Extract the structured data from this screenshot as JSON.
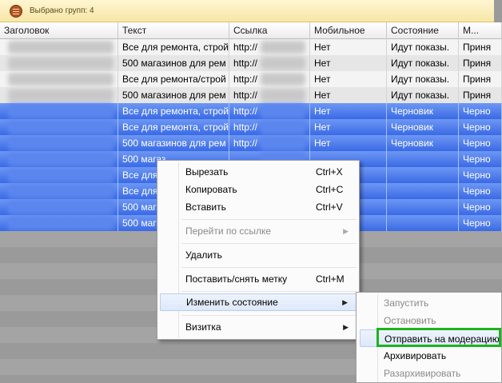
{
  "group_bar": {
    "label": "Выбрано групп: 4"
  },
  "table": {
    "columns": [
      "Заголовок",
      "Текст",
      "Ссылка",
      "Мобильное",
      "Состояние",
      "М..."
    ],
    "rows": [
      {
        "text": "Все для ремонта, строй",
        "link": "http://",
        "mobile": "Нет",
        "state": "Идут показы.",
        "m": "Приня",
        "selected": false
      },
      {
        "text": "500 магазинов для рем",
        "link": "http://",
        "mobile": "Нет",
        "state": "Идут показы.",
        "m": "Приня",
        "selected": false
      },
      {
        "text": "Все для ремонта/строй",
        "link": "http://",
        "mobile": "Нет",
        "state": "Идут показы.",
        "m": "Приня",
        "selected": false
      },
      {
        "text": "500 магазинов для рем",
        "link": "http://",
        "mobile": "Нет",
        "state": "Идут показы.",
        "m": "Приня",
        "selected": false
      },
      {
        "text": "Все для ремонта, строй",
        "link": "http://",
        "mobile": "Нет",
        "state": "Черновик",
        "m": "Черно",
        "selected": true
      },
      {
        "text": "Все для ремонта, строй",
        "link": "http://",
        "mobile": "Нет",
        "state": "Черновик",
        "m": "Черно",
        "selected": true
      },
      {
        "text": "500 магазинов для рем",
        "link": "http://",
        "mobile": "Нет",
        "state": "Черновик",
        "m": "Черно",
        "selected": true
      },
      {
        "text": "500 магаз",
        "link": "",
        "mobile": "",
        "state": "",
        "m": "Черно",
        "selected": true
      },
      {
        "text": "Все для",
        "link": "",
        "mobile": "",
        "state": "",
        "m": "Черно",
        "selected": true
      },
      {
        "text": "Все для",
        "link": "",
        "mobile": "",
        "state": "",
        "m": "Черно",
        "selected": true
      },
      {
        "text": "500 магаз",
        "link": "",
        "mobile": "",
        "state": "",
        "m": "Черно",
        "selected": true
      },
      {
        "text": "500 магаз",
        "link": "",
        "mobile": "",
        "state": "",
        "m": "Черно",
        "selected": true
      }
    ]
  },
  "context_menu": {
    "cut": "Вырезать",
    "cut_sc": "Ctrl+X",
    "copy": "Копировать",
    "copy_sc": "Ctrl+C",
    "paste": "Вставить",
    "paste_sc": "Ctrl+V",
    "follow_link": "Перейти по ссылке",
    "delete": "Удалить",
    "toggle_mark": "Поставить/снять метку",
    "toggle_mark_sc": "Ctrl+M",
    "change_state": "Изменить состояние",
    "card": "Визитка"
  },
  "state_submenu": {
    "start": "Запустить",
    "stop": "Остановить",
    "send_moderation": "Отправить на модерацию",
    "archive": "Архивировать",
    "unarchive": "Разархивировать"
  },
  "colors": {
    "selection": "#3a6ae6",
    "highlight_box": "#1fb21f",
    "group_bar": "#f7e6a6"
  }
}
